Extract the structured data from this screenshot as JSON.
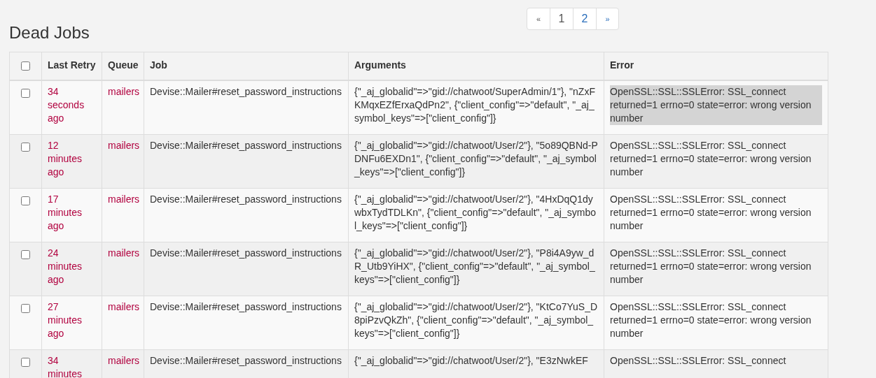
{
  "pagination": [
    {
      "label": "«",
      "kind": "prev"
    },
    {
      "label": "1",
      "kind": "page",
      "selected": true
    },
    {
      "label": "2",
      "kind": "page",
      "selected": false
    },
    {
      "label": "»",
      "kind": "next"
    }
  ],
  "title": "Dead Jobs",
  "table": {
    "select_all": {
      "checked": false
    },
    "columns": [
      "Last Retry",
      "Queue",
      "Job",
      "Arguments",
      "Error"
    ],
    "rows": [
      {
        "checked": false,
        "last_retry": "34 seconds ago",
        "queue": "mailers",
        "job": "Devise::Mailer#reset_password_instructions",
        "arguments": "{\"_aj_globalid\"=>\"gid://chatwoot/SuperAdmin/1\"}, \"nZxFKMqxEZfErxaQdPn2\", {\"client_config\"=>\"default\", \"_aj_symbol_keys\"=>[\"client_config\"]}",
        "error": "OpenSSL::SSL::SSLError: SSL_connect returned=1 errno=0 state=error: wrong version number",
        "error_highlighted": true
      },
      {
        "checked": false,
        "last_retry": "12 minutes ago",
        "queue": "mailers",
        "job": "Devise::Mailer#reset_password_instructions",
        "arguments": "{\"_aj_globalid\"=>\"gid://chatwoot/User/2\"}, \"5o89QBNd-PDNFu6EXDn1\", {\"client_config\"=>\"default\", \"_aj_symbol_keys\"=>[\"client_config\"]}",
        "error": "OpenSSL::SSL::SSLError: SSL_connect returned=1 errno=0 state=error: wrong version number",
        "error_highlighted": false
      },
      {
        "checked": false,
        "last_retry": "17 minutes ago",
        "queue": "mailers",
        "job": "Devise::Mailer#reset_password_instructions",
        "arguments": "{\"_aj_globalid\"=>\"gid://chatwoot/User/2\"}, \"4HxDqQ1dywbxTydTDLKn\", {\"client_config\"=>\"default\", \"_aj_symbol_keys\"=>[\"client_config\"]}",
        "error": "OpenSSL::SSL::SSLError: SSL_connect returned=1 errno=0 state=error: wrong version number",
        "error_highlighted": false
      },
      {
        "checked": false,
        "last_retry": "24 minutes ago",
        "queue": "mailers",
        "job": "Devise::Mailer#reset_password_instructions",
        "arguments": "{\"_aj_globalid\"=>\"gid://chatwoot/User/2\"}, \"P8i4A9yw_dR_Utb9YiHX\", {\"client_config\"=>\"default\", \"_aj_symbol_keys\"=>[\"client_config\"]}",
        "error": "OpenSSL::SSL::SSLError: SSL_connect returned=1 errno=0 state=error: wrong version number",
        "error_highlighted": false
      },
      {
        "checked": false,
        "last_retry": "27 minutes ago",
        "queue": "mailers",
        "job": "Devise::Mailer#reset_password_instructions",
        "arguments": "{\"_aj_globalid\"=>\"gid://chatwoot/User/2\"}, \"KtCo7YuS_D8piPzvQkZh\", {\"client_config\"=>\"default\", \"_aj_symbol_keys\"=>[\"client_config\"]}",
        "error": "OpenSSL::SSL::SSLError: SSL_connect returned=1 errno=0 state=error: wrong version number",
        "error_highlighted": false
      },
      {
        "checked": false,
        "last_retry": "34 minutes",
        "queue": "mailers",
        "job": "Devise::Mailer#reset_password_instructions",
        "arguments": "{\"_aj_globalid\"=>\"gid://chatwoot/User/2\"}, \"E3zNwkEF",
        "error": "OpenSSL::SSL::SSLError: SSL_connect",
        "error_highlighted": false
      }
    ]
  }
}
